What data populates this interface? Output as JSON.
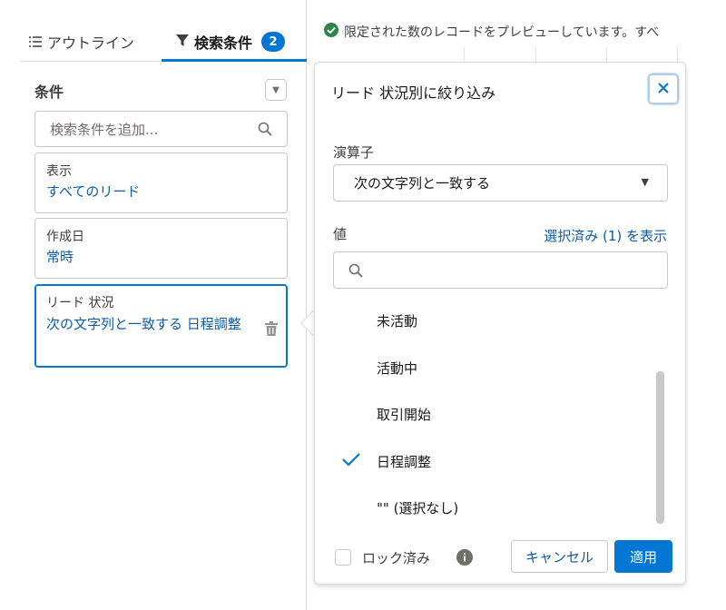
{
  "tabs": {
    "outline_label": "アウトライン",
    "filters_label": "検索条件",
    "filters_count": "2"
  },
  "conditions": {
    "title": "条件",
    "search_placeholder": "検索条件を追加...",
    "cards": [
      {
        "label": "表示",
        "value": "すべてのリード"
      },
      {
        "label": "作成日",
        "value": "常時"
      },
      {
        "label": "リード 状況",
        "value": "次の文字列と一致する 日程調整"
      }
    ]
  },
  "preview": {
    "message": "限定された数のレコードをプレビューしています。すべ"
  },
  "popover": {
    "title": "リード 状況別に絞り込み",
    "operator_label": "演算子",
    "operator_value": "次の文字列と一致する",
    "value_label": "値",
    "show_selected_link": "選択済み (1) を表示",
    "options": [
      {
        "label": "未活動",
        "checked": false
      },
      {
        "label": "活動中",
        "checked": false
      },
      {
        "label": "取引開始",
        "checked": false
      },
      {
        "label": "日程調整",
        "checked": true
      },
      {
        "label": "\"\" (選択なし)",
        "checked": false
      }
    ],
    "locked_label": "ロック済み",
    "cancel_label": "キャンセル",
    "apply_label": "適用"
  },
  "colors": {
    "brand": "#0176d3",
    "link": "#0b5cab",
    "success": "#2e844a"
  }
}
